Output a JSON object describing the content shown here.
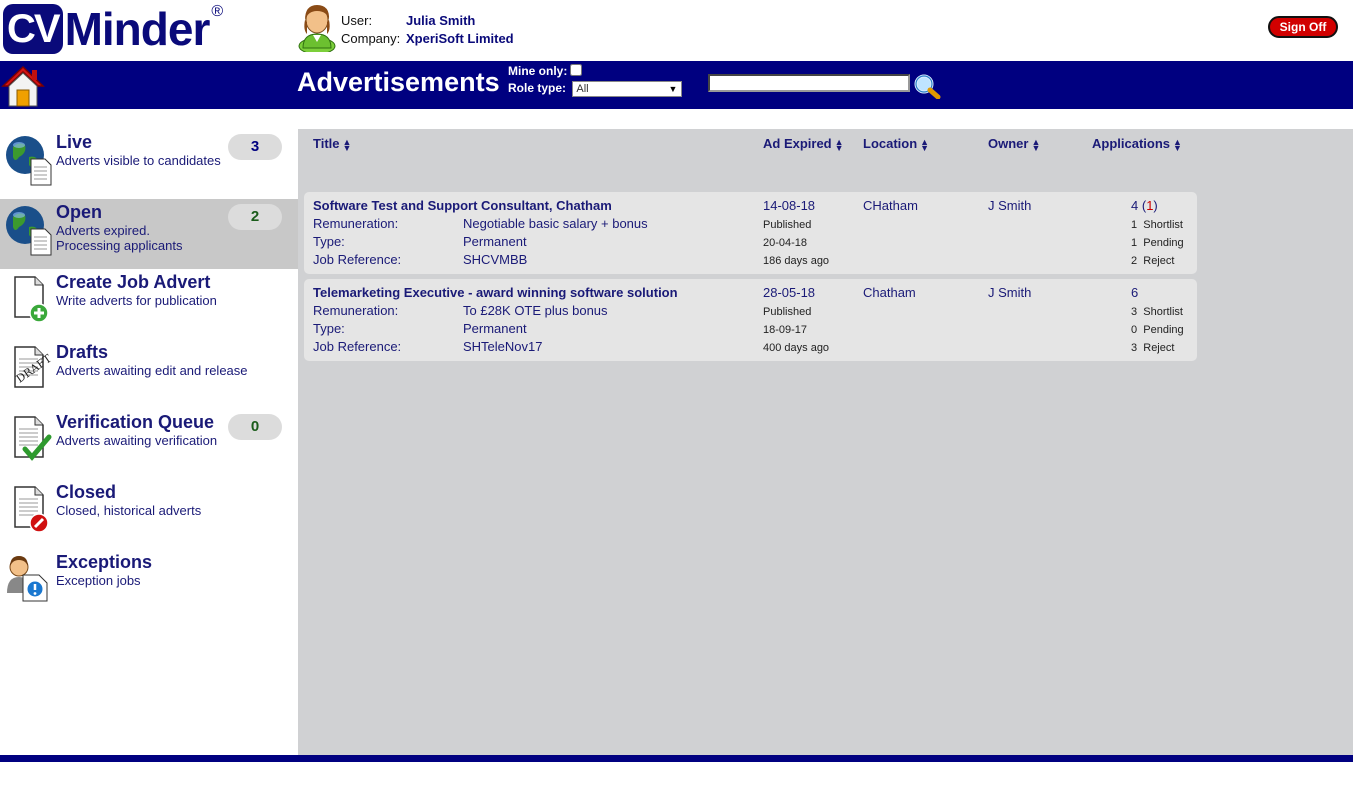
{
  "header": {
    "logo_cv": "CV",
    "logo_minder": "Minder",
    "logo_reg": "®",
    "user_label": "User:",
    "user_name": "Julia Smith",
    "company_label": "Company:",
    "company_name": "XperiSoft Limited",
    "signoff_label": "Sign Off"
  },
  "navbar": {
    "page_title": "Advertisements",
    "mine_only_label": "Mine only:",
    "mine_only_checked": false,
    "role_type_label": "Role type:",
    "role_type_value": "All",
    "search_value": ""
  },
  "sidebar": {
    "items": [
      {
        "title": "Live",
        "subtitle": "Adverts visible to candidates",
        "count": "3",
        "count_color": "#000080",
        "icon": "globe-document-icon",
        "active": false
      },
      {
        "title": "Open",
        "subtitle": "Adverts expired.\nProcessing applicants",
        "count": "2",
        "count_color": "#1a5c1a",
        "icon": "globe-document-icon",
        "active": true
      },
      {
        "title": "Create Job Advert",
        "subtitle": "Write adverts for publication",
        "count": "",
        "icon": "new-document-icon",
        "active": false
      },
      {
        "title": "Drafts",
        "subtitle": "Adverts awaiting edit and release",
        "count": "",
        "icon": "draft-document-icon",
        "active": false
      },
      {
        "title": "Verification Queue",
        "subtitle": "Adverts awaiting verification",
        "count": "0",
        "count_color": "#1a5c1a",
        "icon": "verified-document-icon",
        "active": false
      },
      {
        "title": "Closed",
        "subtitle": "Closed, historical adverts",
        "count": "",
        "icon": "closed-document-icon",
        "active": false
      },
      {
        "title": "Exceptions",
        "subtitle": "Exception jobs",
        "count": "",
        "icon": "exception-user-icon",
        "active": false
      }
    ]
  },
  "table": {
    "columns": [
      "Title",
      "Ad Expired",
      "Location",
      "Owner",
      "Applications"
    ],
    "field_labels": {
      "remuneration": "Remuneration:",
      "type": "Type:",
      "job_reference": "Job Reference:"
    },
    "status_labels": {
      "shortlist": "Shortlist",
      "pending": "Pending",
      "reject": "Reject"
    },
    "rows": [
      {
        "title": "Software Test and Support Consultant, Chatham",
        "remuneration": "Negotiable basic salary + bonus",
        "type": "Permanent",
        "job_reference": "SHCVMBB",
        "ad_expired": "14-08-18",
        "published_label": "Published",
        "published_date": "20-04-18",
        "days_ago": "186 days ago",
        "location": "CHatham",
        "owner": "J Smith",
        "applications": "4",
        "applications_new": "1",
        "shortlist": "1",
        "pending": "1",
        "reject": "2"
      },
      {
        "title": "Telemarketing Executive - award winning software solution",
        "remuneration": "To £28K OTE plus bonus",
        "type": "Permanent",
        "job_reference": "SHTeleNov17",
        "ad_expired": "28-05-18",
        "published_label": "Published",
        "published_date": "18-09-17",
        "days_ago": "400 days ago",
        "location": "Chatham",
        "owner": "J Smith",
        "applications": "6",
        "applications_new": "",
        "shortlist": "3",
        "pending": "0",
        "reject": "3"
      }
    ]
  }
}
